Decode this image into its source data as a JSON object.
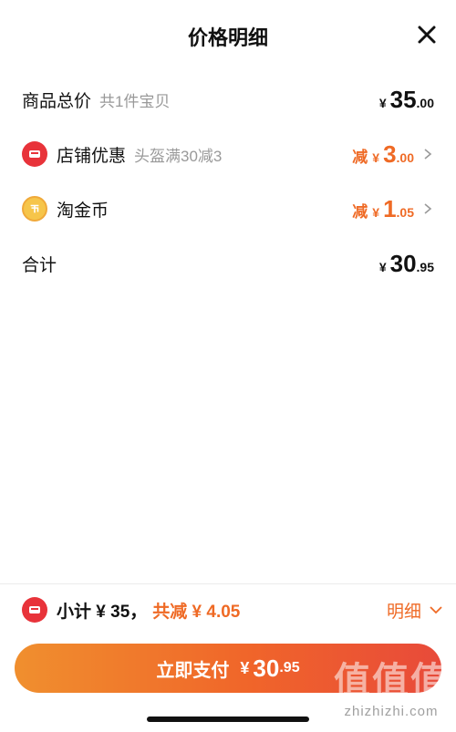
{
  "header": {
    "title": "价格明细"
  },
  "rows": [
    {
      "label": "商品总价",
      "sub": "共1件宝贝",
      "currency": "¥",
      "int": "35",
      "dec": ".00"
    },
    {
      "label": "店铺优惠",
      "sub": "头盔满30减3",
      "minus": "减",
      "currency": "¥",
      "int": "3",
      "dec": ".00"
    },
    {
      "label": "淘金币",
      "minus": "减",
      "currency": "¥",
      "int": "1",
      "dec": ".05"
    },
    {
      "label": "合计",
      "currency": "¥",
      "int": "30",
      "dec": ".95"
    }
  ],
  "summary": {
    "subtotal": "小计 ¥ 35，",
    "saved": "共减 ¥ 4.05",
    "detail_label": "明细"
  },
  "pay": {
    "label": "立即支付",
    "currency": "¥",
    "int": "30",
    "dec": ".95"
  },
  "watermark": {
    "text": "值值值",
    "url": "zhizhizhi.com"
  },
  "colors": {
    "accent": "#ef6a25",
    "shop_icon": "#e8333a",
    "coin_icon": "#f6c54a"
  },
  "icons": {
    "close": "close-icon",
    "shop": "shop-icon",
    "coin": "coin-icon",
    "chevron_right": "chevron-right-icon",
    "chevron_down": "chevron-down-icon",
    "coupon": "coupon-icon"
  }
}
